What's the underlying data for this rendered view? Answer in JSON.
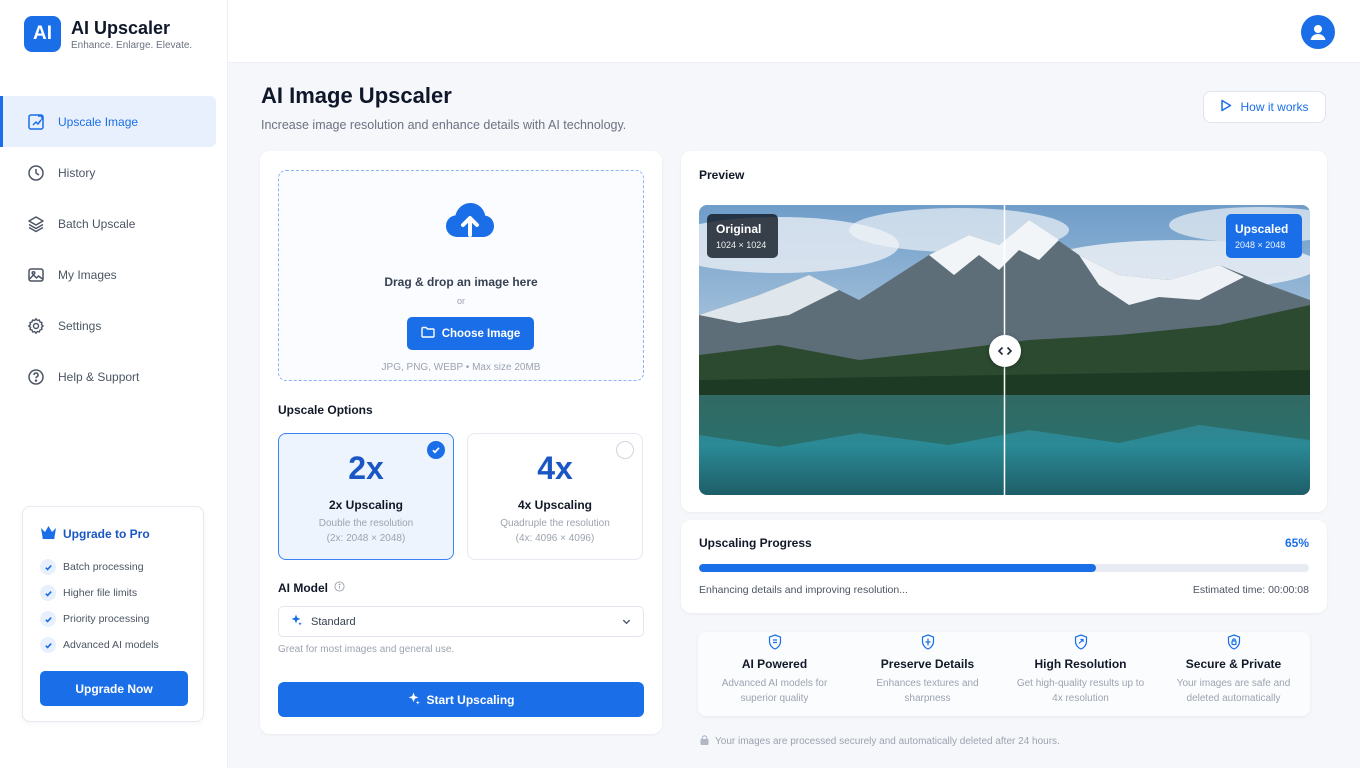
{
  "brand": {
    "logo": "AI",
    "title": "AI Upscaler",
    "tagline": "Enhance. Enlarge. Elevate."
  },
  "nav": [
    {
      "label": "Upscale Image",
      "icon": "upscale-icon",
      "active": true
    },
    {
      "label": "History",
      "icon": "clock-icon"
    },
    {
      "label": "Batch Upscale",
      "icon": "layers-icon"
    },
    {
      "label": "My Images",
      "icon": "image-icon"
    },
    {
      "label": "Settings",
      "icon": "gear-icon"
    },
    {
      "label": "Help & Support",
      "icon": "help-icon"
    }
  ],
  "pro": {
    "title": "Upgrade to Pro",
    "features": [
      "Batch processing",
      "Higher file limits",
      "Priority processing",
      "Advanced AI models"
    ],
    "button": "Upgrade Now"
  },
  "header": {
    "title": "AI Image Upscaler",
    "subtitle": "Increase image resolution and enhance details with AI technology.",
    "how_it_works": "How it works"
  },
  "upload": {
    "title": "Drag & drop an image here",
    "or": "or",
    "button": "Choose Image",
    "formats": "JPG, PNG, WEBP  •  Max size 20MB"
  },
  "options": {
    "label": "Upscale Options",
    "cards": [
      {
        "big": "2x",
        "name": "2x Upscaling",
        "desc": "Double the resolution",
        "res": "(2x: 2048 × 2048)",
        "selected": true
      },
      {
        "big": "4x",
        "name": "4x Upscaling",
        "desc": "Quadruple the resolution",
        "res": "(4x: 4096 × 4096)",
        "selected": false
      }
    ]
  },
  "model": {
    "label": "AI Model",
    "selected": "Standard",
    "help": "Great for most images and general use."
  },
  "start_button": "Start Upscaling",
  "preview": {
    "title": "Preview",
    "original_label": "Original",
    "original_size": "1024 × 1024",
    "upscaled_label": "Upscaled",
    "upscaled_size": "2048 × 2048"
  },
  "progress": {
    "title": "Upscaling Progress",
    "percent_text": "65%",
    "value": 0.65,
    "status": "Enhancing details and improving resolution...",
    "eta": "Estimated time: 00:00:08"
  },
  "features": [
    {
      "title": "AI Powered",
      "desc": "Advanced AI models for superior quality",
      "icon": "ai-chip-icon"
    },
    {
      "title": "Preserve Details",
      "desc": "Enhances textures and sharpness",
      "icon": "details-icon"
    },
    {
      "title": "High Resolution",
      "desc": "Get high-quality results up to 4x resolution",
      "icon": "resolution-icon"
    },
    {
      "title": "Secure & Private",
      "desc": "Your images are safe and deleted automatically",
      "icon": "shield-icon"
    }
  ],
  "secure_note": "Your images are processed securely and automatically deleted after 24 hours.",
  "colors": {
    "accent": "#1a6fe8",
    "background": "#f5f7fb",
    "panel": "#ffffff"
  }
}
